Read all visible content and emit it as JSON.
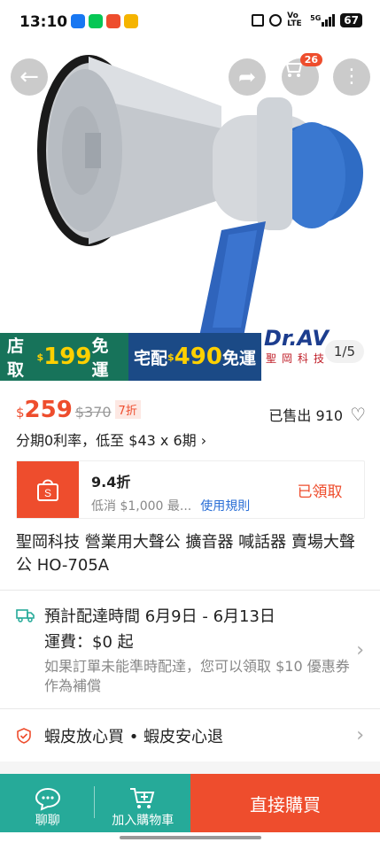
{
  "status": {
    "time": "13:10",
    "network": "Vo LTE",
    "signal": "5G",
    "battery": "67"
  },
  "header": {
    "cart_count": "26"
  },
  "gallery": {
    "promo_store_pickup": "店取",
    "promo_store_amount": "199",
    "promo_store_free": "免運",
    "promo_home_delivery": "宅配",
    "promo_home_amount": "490",
    "promo_home_free": "免運",
    "currency_mark": "$",
    "brand": "Dr.AV",
    "brand_sub": "聖岡科技",
    "page_indicator": "1/5"
  },
  "product": {
    "currency": "$",
    "price": "259",
    "original_price": "$370",
    "discount": "7折",
    "sold_label": "已售出 910",
    "installment": "分期0利率，低至 $43 x 6期 ›",
    "title": "聖岡科技 營業用大聲公 擴音器 喊話器 賣場大聲公 HO-705A"
  },
  "voucher": {
    "title": "9.4折",
    "condition": "低消 $1,000 最...",
    "rules_link": "使用規則",
    "status": "已領取"
  },
  "shipping": {
    "estimate": "預計配達時間 6月9日 - 6月13日",
    "fee": "運費：$0 起",
    "note": "如果訂單未能準時配達，您可以領取 $10 優惠券作為補償"
  },
  "guarantee": {
    "text": "蝦皮放心買 • 蝦皮安心退"
  },
  "bottom_bar": {
    "chat_label": "聊聊",
    "add_cart_label": "加入購物車",
    "buy_now_label": "直接購買"
  },
  "colors": {
    "brand_orange": "#ee4d2d",
    "teal": "#26aa99",
    "link_blue": "#2a6fd6"
  }
}
